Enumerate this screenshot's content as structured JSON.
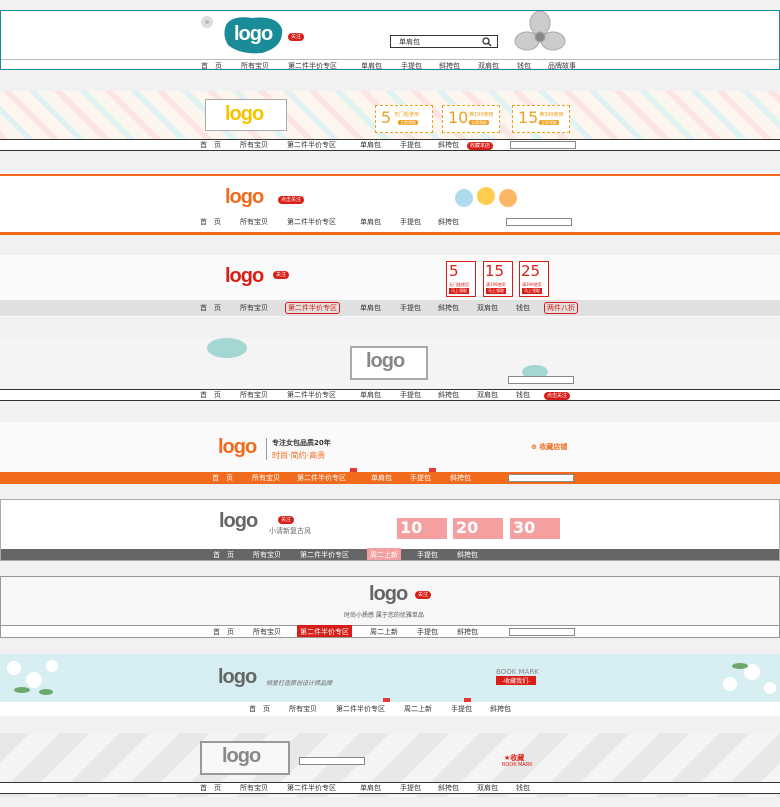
{
  "colors": {
    "teal": "#1a8c99",
    "orange": "#f26b1d",
    "red": "#d91e18",
    "gold": "#f0a020",
    "pink": "#f5a0a0",
    "gray": "#666666"
  },
  "b1": {
    "logo": "logo",
    "follow": "关注",
    "search": "单肩包",
    "nav": [
      "首　页",
      "所有宝贝",
      "第二件半价专区",
      "单肩包",
      "手提包",
      "斜挎包",
      "双肩包",
      "钱包",
      "品牌故事"
    ]
  },
  "b2": {
    "logo": "logo",
    "coupons": [
      "5",
      "10",
      "15"
    ],
    "coupon_subs": [
      "无门槛使用",
      "满199使用",
      "满399使用"
    ],
    "coupon_btn": "立即领取",
    "collect": "收藏本店",
    "nav": [
      "首　页",
      "所有宝贝",
      "第二件半价专区",
      "单肩包",
      "手提包",
      "斜挎包"
    ]
  },
  "b3": {
    "logo": "logo",
    "follow": "点击关注",
    "nav": [
      "首　页",
      "所有宝贝",
      "第二件半价专区",
      "单肩包",
      "手提包",
      "斜挎包"
    ]
  },
  "b4": {
    "logo": "logo",
    "follow": "关注",
    "coupons": [
      "5",
      "15",
      "25"
    ],
    "coupon_subs": [
      "无门槛使用",
      "满199使用",
      "满399使用"
    ],
    "coupon_btn": "马上领取",
    "nav": [
      "首　页",
      "所有宝贝",
      "第二件半价专区",
      "单肩包",
      "手提包",
      "斜挎包",
      "双肩包",
      "钱包",
      "两件八折"
    ]
  },
  "b5": {
    "logo": "logo",
    "follow": "点击关注",
    "nav": [
      "首　页",
      "所有宝贝",
      "第二件半价专区",
      "单肩包",
      "手提包",
      "斜挎包",
      "双肩包",
      "钱包"
    ]
  },
  "b6": {
    "logo": "logo",
    "slogan1": "专注女包品质20年",
    "slogan2": "时尚·简约·高贵",
    "collect": "收藏店铺",
    "nav": [
      "首　页",
      "所有宝贝",
      "第二件半价专区",
      "单肩包",
      "手提包",
      "斜挎包"
    ]
  },
  "b7": {
    "logo": "logo",
    "follow": "关注",
    "slogan": "小清新复古风",
    "coupons": [
      "10",
      "20",
      "30"
    ],
    "nav": [
      "首　页",
      "所有宝贝",
      "第二件半价专区",
      "周二上新",
      "手提包",
      "斜挎包"
    ]
  },
  "b8": {
    "logo": "logo",
    "follow": "关注",
    "slogan": "时尚小质感  属于您的优雅单品",
    "nav": [
      "首　页",
      "所有宝贝",
      "第二件半价专区",
      "周二上新",
      "手提包",
      "斜挎包"
    ]
  },
  "b9": {
    "logo": "logo",
    "slogan": "倾爱打造原创设计师品牌",
    "bookmark": "BOOK  MARK",
    "bookmark_btn": "-收藏我们-",
    "nav": [
      "首　页",
      "所有宝贝",
      "第二件半价专区",
      "周二上新",
      "手提包",
      "斜挎包"
    ]
  },
  "b10": {
    "logo": "logo",
    "collect": "收藏",
    "bookmark": "BOOK MARK",
    "nav": [
      "首　页",
      "所有宝贝",
      "第二件半价专区",
      "单肩包",
      "手提包",
      "斜挎包",
      "双肩包",
      "钱包"
    ]
  }
}
